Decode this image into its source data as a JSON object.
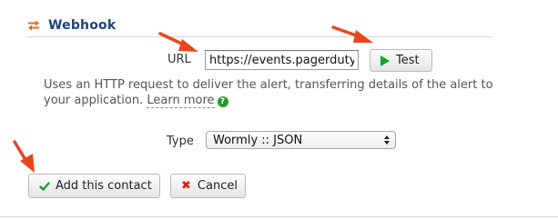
{
  "section": {
    "title": "Webhook",
    "icon": "transfer-arrows-icon"
  },
  "url": {
    "label": "URL",
    "value": "https://events.pagerduty"
  },
  "test_button": {
    "label": "Test"
  },
  "description": {
    "text": "Uses an HTTP request to deliver the alert, transferring details of the alert to your application.",
    "learn_more": "Learn more",
    "help_symbol": "?"
  },
  "type": {
    "label": "Type",
    "selected": "Wormly :: JSON"
  },
  "add_button": {
    "label": "Add this contact"
  },
  "cancel_button": {
    "label": "Cancel",
    "symbol": "✖"
  },
  "colors": {
    "header_text": "#20447a",
    "header_icon": "#e86b1b",
    "annotation_arrow": "#e8461e",
    "success_green": "#17a32b",
    "cancel_red": "#d42121"
  }
}
